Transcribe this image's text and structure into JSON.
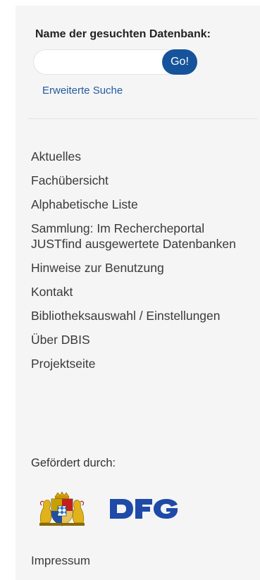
{
  "search": {
    "title": "Name der gesuchten Datenbank:",
    "placeholder": "",
    "value": "",
    "go_label": "Go!",
    "advanced_link": "Erweiterte Suche"
  },
  "nav": {
    "items": [
      {
        "label": "Aktuelles"
      },
      {
        "label": "Fachübersicht"
      },
      {
        "label": "Alphabetische Liste"
      },
      {
        "label": "Sammlung: Im Rechercheportal JUSTfind ausgewertete Datenbanken"
      },
      {
        "label": "Hinweise zur Benutzung"
      },
      {
        "label": "Kontakt"
      },
      {
        "label": "Bibliotheksauswahl / Einstellungen"
      },
      {
        "label": "Über DBIS"
      },
      {
        "label": "Projektseite"
      }
    ]
  },
  "funding": {
    "label": "Gefördert durch:",
    "logos": [
      "bavarian-coat-of-arms",
      "DFG"
    ]
  },
  "footer": {
    "imprint": "Impressum"
  },
  "colors": {
    "accent": "#15549a",
    "link": "#1f5c9e",
    "panel_bg": "#f5f5f5"
  }
}
